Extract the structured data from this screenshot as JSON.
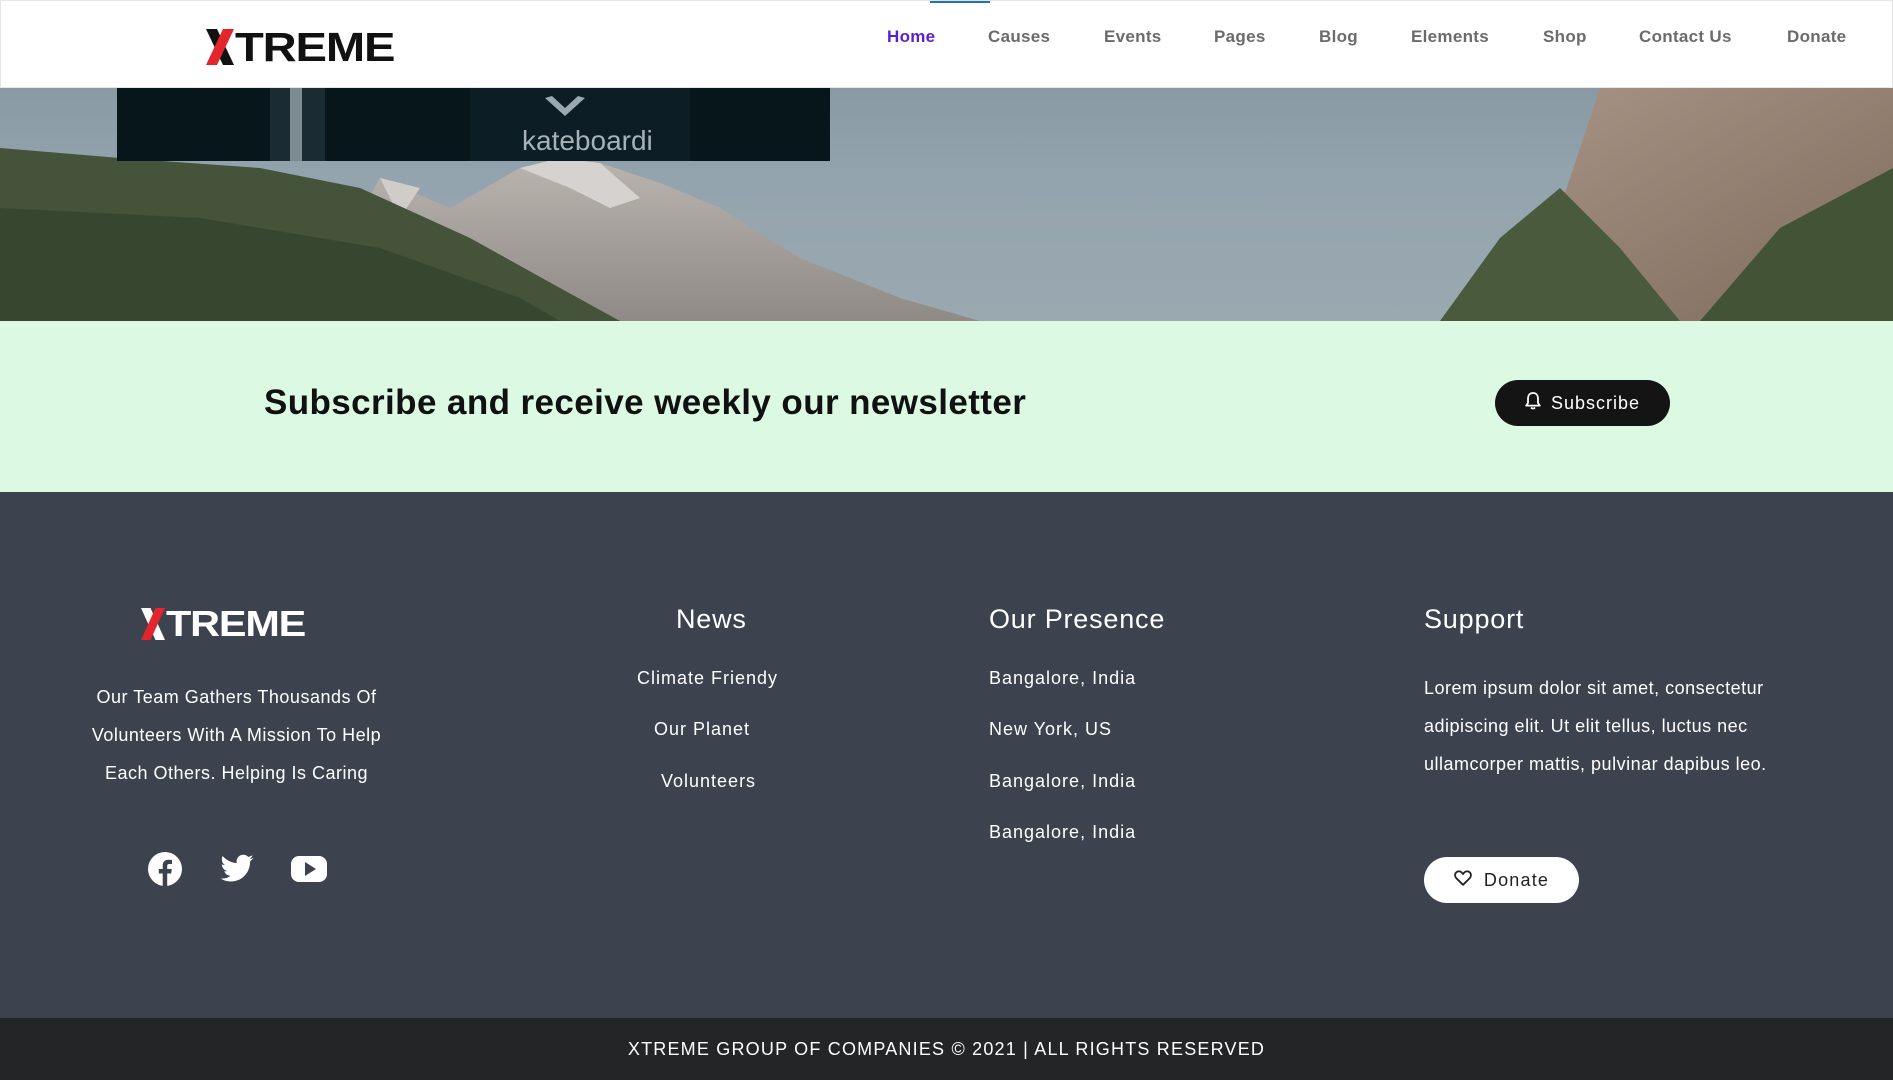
{
  "header": {
    "logo_text": "XTREME",
    "nav": [
      {
        "label": "Home",
        "active": true
      },
      {
        "label": "Causes"
      },
      {
        "label": "Events"
      },
      {
        "label": "Pages"
      },
      {
        "label": "Blog"
      },
      {
        "label": "Elements"
      },
      {
        "label": "Shop"
      },
      {
        "label": "Contact Us"
      },
      {
        "label": "Donate"
      }
    ]
  },
  "hero": {
    "shirt_text": "kateboardi"
  },
  "newsletter": {
    "title": "Subscribe and receive weekly our newsletter",
    "button_label": "Subscribe",
    "button_icon": "bell-icon"
  },
  "footer": {
    "logo_text": "XTREME",
    "about_lines": [
      "Our Team Gathers Thousands Of",
      "Volunteers With A Mission To Help",
      "Each Others. Helping Is Caring"
    ],
    "social": [
      "facebook-icon",
      "twitter-icon",
      "youtube-icon"
    ],
    "news": {
      "title": "News",
      "links": [
        "Climate Friendy",
        "Our Planet",
        "Volunteers"
      ]
    },
    "presence": {
      "title": "Our Presence",
      "links": [
        "Bangalore, India",
        "New York, US",
        "Bangalore, India",
        "Bangalore, India"
      ]
    },
    "support": {
      "title": "Support",
      "text": "Lorem ipsum dolor sit amet, consectetur adipiscing elit. Ut elit tellus, luctus nec ullamcorper mattis, pulvinar dapibus leo.",
      "donate_label": "Donate",
      "donate_icon": "heart-icon"
    },
    "copyright": "XTREME GROUP OF COMPANIES © 2021 | ALL RIGHTS RESERVED"
  },
  "colors": {
    "accent_nav_active": "#5a1fd0",
    "newsletter_bg": "#dcfae3",
    "footer_bg": "#3c424e",
    "copyright_bg": "#232527",
    "logo_red": "#e3262b"
  }
}
